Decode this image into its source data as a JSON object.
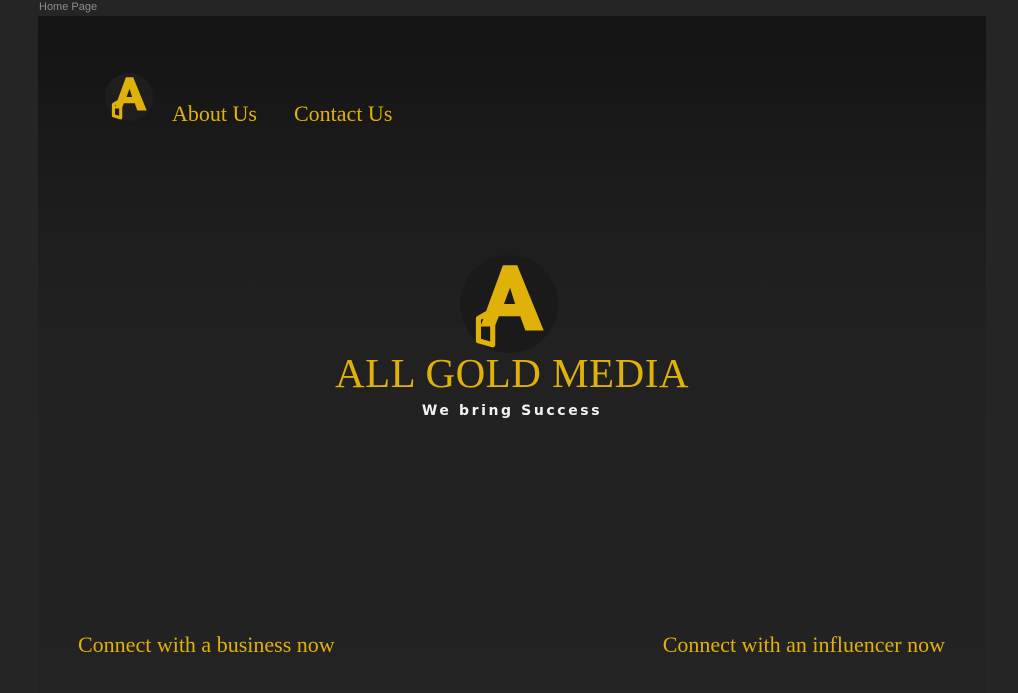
{
  "frame": {
    "label": "Home Page"
  },
  "nav": {
    "logo_icon": "gold-a-logo-icon",
    "links": [
      {
        "label": "About Us"
      },
      {
        "label": "Contact Us"
      }
    ]
  },
  "hero": {
    "logo_icon": "gold-a-logo-icon",
    "title": "ALL GOLD MEDIA",
    "tagline": "We bring Success"
  },
  "cta": {
    "business_label": "Connect with a business now",
    "influencer_label": "Connect with an influencer now"
  },
  "colors": {
    "page_background": "#252525",
    "frame_background": "#1c1c1c",
    "accent_gold": "#e0b109",
    "tagline_text": "#f2f2f2",
    "logo_circle": "#1e1e1e"
  }
}
